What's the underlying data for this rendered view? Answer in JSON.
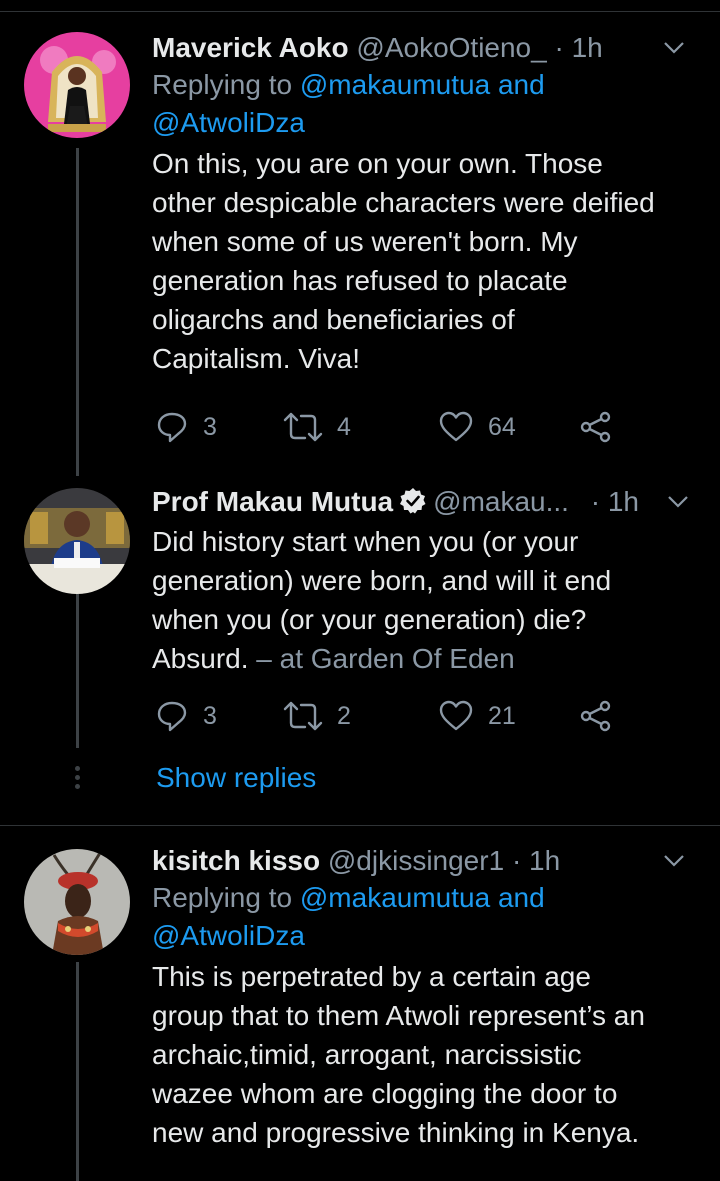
{
  "tweets": [
    {
      "name": "Maverick Aoko",
      "handle": "@AokoOtieno_",
      "time": "· 1h",
      "replying_prefix": "Replying to ",
      "replying_to_line1": "@makaumutua and",
      "replying_to_line2": "@AtwoliDza",
      "text_lines": [
        "On this, you are on your own. Those",
        "other despicable characters were deified",
        "when some of us weren't born. My",
        "generation has refused to placate",
        "oligarchs and beneficiaries of",
        "Capitalism. Viva!"
      ],
      "replies": "3",
      "retweets": "4",
      "likes": "64"
    },
    {
      "name": "Prof Makau Mutua",
      "verified": true,
      "handle": "@makau...",
      "time": "· 1h",
      "text_lines": [
        "Did history start when you (or your",
        "generation) were born, and will it end",
        "when you (or your generation) die?"
      ],
      "text_last": "Absurd.",
      "location": " – at Garden Of Eden",
      "replies": "3",
      "retweets": "2",
      "likes": "21"
    },
    {
      "name": "kisitch kisso",
      "handle": "@djkissinger1",
      "time": "· 1h",
      "replying_prefix": "Replying to ",
      "replying_to_line1": "@makaumutua and",
      "replying_to_line2": "@AtwoliDza",
      "text_lines": [
        "This is perpetrated by a certain age",
        "group that to them Atwoli represent’s an",
        "archaic,timid, arrogant, narcissistic",
        "wazee whom are clogging the door to",
        "new and progressive thinking in Kenya."
      ]
    }
  ],
  "show_replies": "Show replies",
  "colors": {
    "background": "#000000",
    "text": "#e7e9ea",
    "secondary": "#8b98a5",
    "link": "#1d9bf0",
    "divider": "#2f3336"
  }
}
